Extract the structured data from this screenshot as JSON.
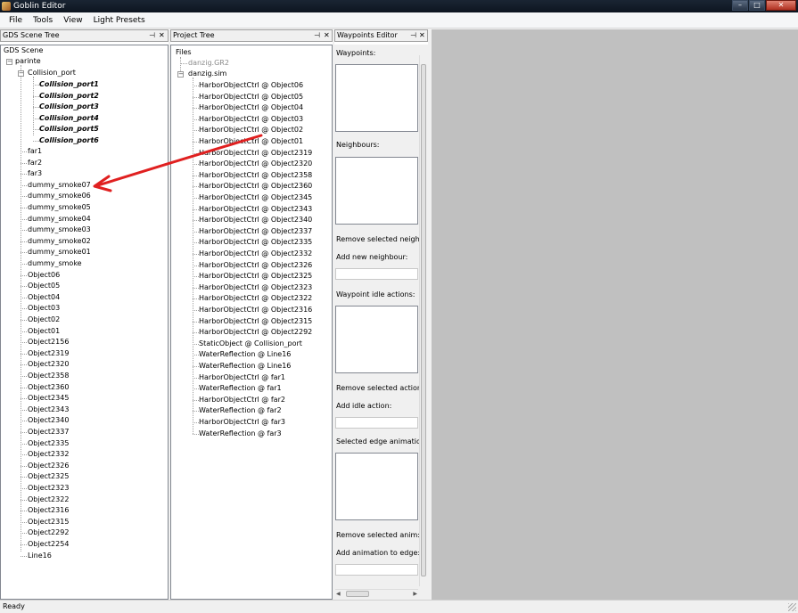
{
  "window": {
    "title": "Goblin Editor",
    "min_glyph": "–",
    "max_glyph": "□",
    "close_glyph": "✕"
  },
  "menu": [
    "File",
    "Tools",
    "View",
    "Light Presets"
  ],
  "scene_tree": {
    "title": "GDS Scene Tree",
    "root": "GDS Scene",
    "parent": "parinte",
    "collision": "Collision_port",
    "collision_children": [
      "Collision_port1",
      "Collision_port2",
      "Collision_port3",
      "Collision_port4",
      "Collision_port5",
      "Collision_port6"
    ],
    "children": [
      "far1",
      "far2",
      "far3",
      "dummy_smoke07",
      "dummy_smoke06",
      "dummy_smoke05",
      "dummy_smoke04",
      "dummy_smoke03",
      "dummy_smoke02",
      "dummy_smoke01",
      "dummy_smoke",
      "Object06",
      "Object05",
      "Object04",
      "Object03",
      "Object02",
      "Object01",
      "Object2156",
      "Object2319",
      "Object2320",
      "Object2358",
      "Object2360",
      "Object2345",
      "Object2343",
      "Object2340",
      "Object2337",
      "Object2335",
      "Object2332",
      "Object2326",
      "Object2325",
      "Object2323",
      "Object2322",
      "Object2316",
      "Object2315",
      "Object2292",
      "Object2254",
      "Line16"
    ]
  },
  "project_tree": {
    "title": "Project Tree",
    "root": "Files",
    "file1": "danzig.GR2",
    "file2": "danzig.sim",
    "children": [
      "HarborObjectCtrl @ Object06",
      "HarborObjectCtrl @ Object05",
      "HarborObjectCtrl @ Object04",
      "HarborObjectCtrl @ Object03",
      "HarborObjectCtrl @ Object02",
      "HarborObjectCtrl @ Object01",
      "HarborObjectCtrl @ Object2319",
      "HarborObjectCtrl @ Object2320",
      "HarborObjectCtrl @ Object2358",
      "HarborObjectCtrl @ Object2360",
      "HarborObjectCtrl @ Object2345",
      "HarborObjectCtrl @ Object2343",
      "HarborObjectCtrl @ Object2340",
      "HarborObjectCtrl @ Object2337",
      "HarborObjectCtrl @ Object2335",
      "HarborObjectCtrl @ Object2332",
      "HarborObjectCtrl @ Object2326",
      "HarborObjectCtrl @ Object2325",
      "HarborObjectCtrl @ Object2323",
      "HarborObjectCtrl @ Object2322",
      "HarborObjectCtrl @ Object2316",
      "HarborObjectCtrl @ Object2315",
      "HarborObjectCtrl @ Object2292",
      "StaticObject @ Collision_port",
      "WaterReflection @ Line16",
      "WaterReflection @ Line16",
      "HarborObjectCtrl @ far1",
      "WaterReflection @ far1",
      "HarborObjectCtrl @ far2",
      "WaterReflection @ far2",
      "HarborObjectCtrl @ far3",
      "WaterReflection @ far3"
    ]
  },
  "waypoints": {
    "title": "Waypoints Editor",
    "waypoints_label": "Waypoints:",
    "neighbours_label": "Neighbours:",
    "remove_neighbour": "Remove selected neighb",
    "add_neighbour": "Add new neighbour:",
    "idle_actions_label": "Waypoint idle actions:",
    "remove_action": "Remove selected action:",
    "add_idle_action": "Add idle action:",
    "edge_animation_label": "Selected edge animation",
    "remove_anim": "Remove selected anim:",
    "add_anim_edge": "Add animation to edge:"
  },
  "panel_glyphs": {
    "pin": "⊣",
    "close": "✕"
  },
  "status": "Ready",
  "colors": {
    "annotation_arrow": "#e02020",
    "workspace": "#c0c0c0"
  }
}
